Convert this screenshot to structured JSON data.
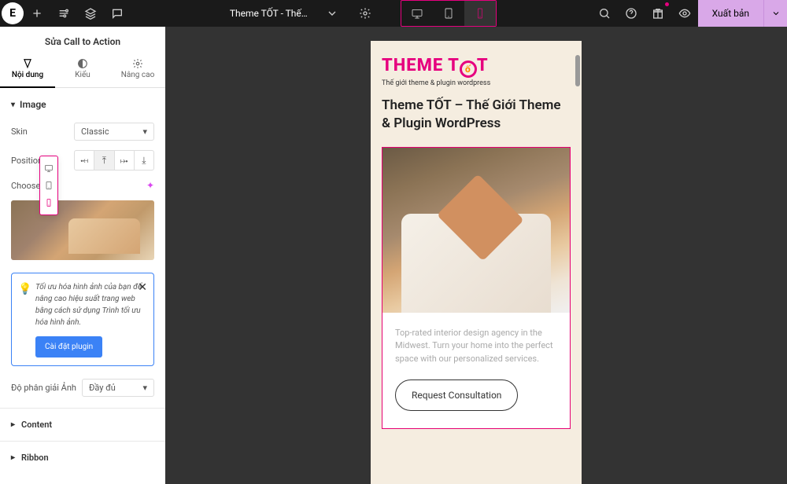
{
  "topbar": {
    "page_title": "Theme TỐT - Thế…",
    "publish_label": "Xuất bản"
  },
  "sidebar": {
    "title": "Sửa Call to Action",
    "tabs": {
      "content": "Nội dung",
      "style": "Kiểu",
      "advanced": "Nâng cao"
    },
    "section_image": "Image",
    "skin_label": "Skin",
    "skin_value": "Classic",
    "position_label": "Position",
    "choose_label": "Choose I",
    "resolution_label": "Độ phân giải Ảnh",
    "resolution_value": "Đầy đủ",
    "tip_text": "Tối ưu hóa hình ảnh của bạn để nâng cao hiệu suất trang web bằng cách sử dụng Trình tối ưu hóa hình ảnh.",
    "tip_button": "Cài đặt plugin",
    "accordion_content": "Content",
    "accordion_ribbon": "Ribbon"
  },
  "preview": {
    "logo_text": "THEME T",
    "logo_t2": "T",
    "logo_sub": "Thế giới theme & plugin wordpress",
    "heading": "Theme TỐT – Thế Giới Theme & Plugin WordPress",
    "cta_text": "Top-rated interior design agency in the Midwest. Turn your home into the perfect space with our personalized services.",
    "cta_button": "Request Consultation"
  }
}
